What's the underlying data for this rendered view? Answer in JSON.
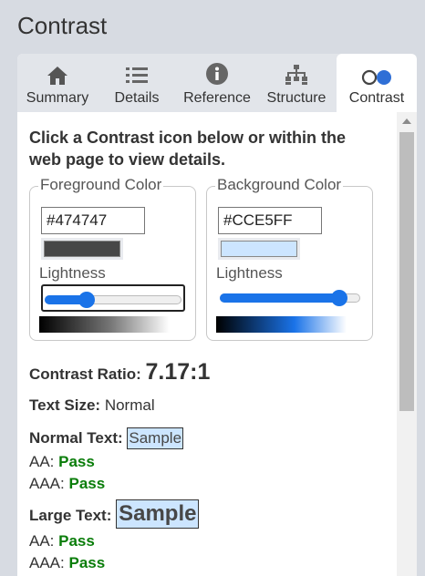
{
  "app": {
    "title": "Contrast"
  },
  "tabs": [
    {
      "label": "Summary",
      "icon": "home-icon"
    },
    {
      "label": "Details",
      "icon": "list-icon"
    },
    {
      "label": "Reference",
      "icon": "info-icon"
    },
    {
      "label": "Structure",
      "icon": "sitemap-icon"
    },
    {
      "label": "Contrast",
      "icon": "contrast-icon",
      "active": true
    }
  ],
  "intro": "Click a Contrast icon below or within the web page to view details.",
  "foreground": {
    "legend": "Foreground Color",
    "hex": "#474747",
    "color": "#474747",
    "lightness_label": "Lightness",
    "lightness_fraction": 0.28
  },
  "background": {
    "legend": "Background Color",
    "hex": "#CCE5FF",
    "color": "#CCE5FF",
    "lightness_label": "Lightness",
    "lightness_fraction": 0.9
  },
  "result": {
    "ratio_label": "Contrast Ratio:",
    "ratio_value": "7.17:1",
    "text_size_label": "Text Size:",
    "text_size_value": "Normal",
    "normal_label": "Normal Text:",
    "normal_sample": "Sample",
    "normal_aa_label": "AA:",
    "normal_aa_value": "Pass",
    "normal_aaa_label": "AAA:",
    "normal_aaa_value": "Pass",
    "large_label": "Large Text:",
    "large_sample": "Sample",
    "large_aa_label": "AA:",
    "large_aa_value": "Pass",
    "large_aaa_label": "AAA:",
    "large_aaa_value": "Pass"
  },
  "colors": {
    "accent": "#1a73e8",
    "pass": "#0a7d0a",
    "page_bg": "#d7dbe2"
  }
}
